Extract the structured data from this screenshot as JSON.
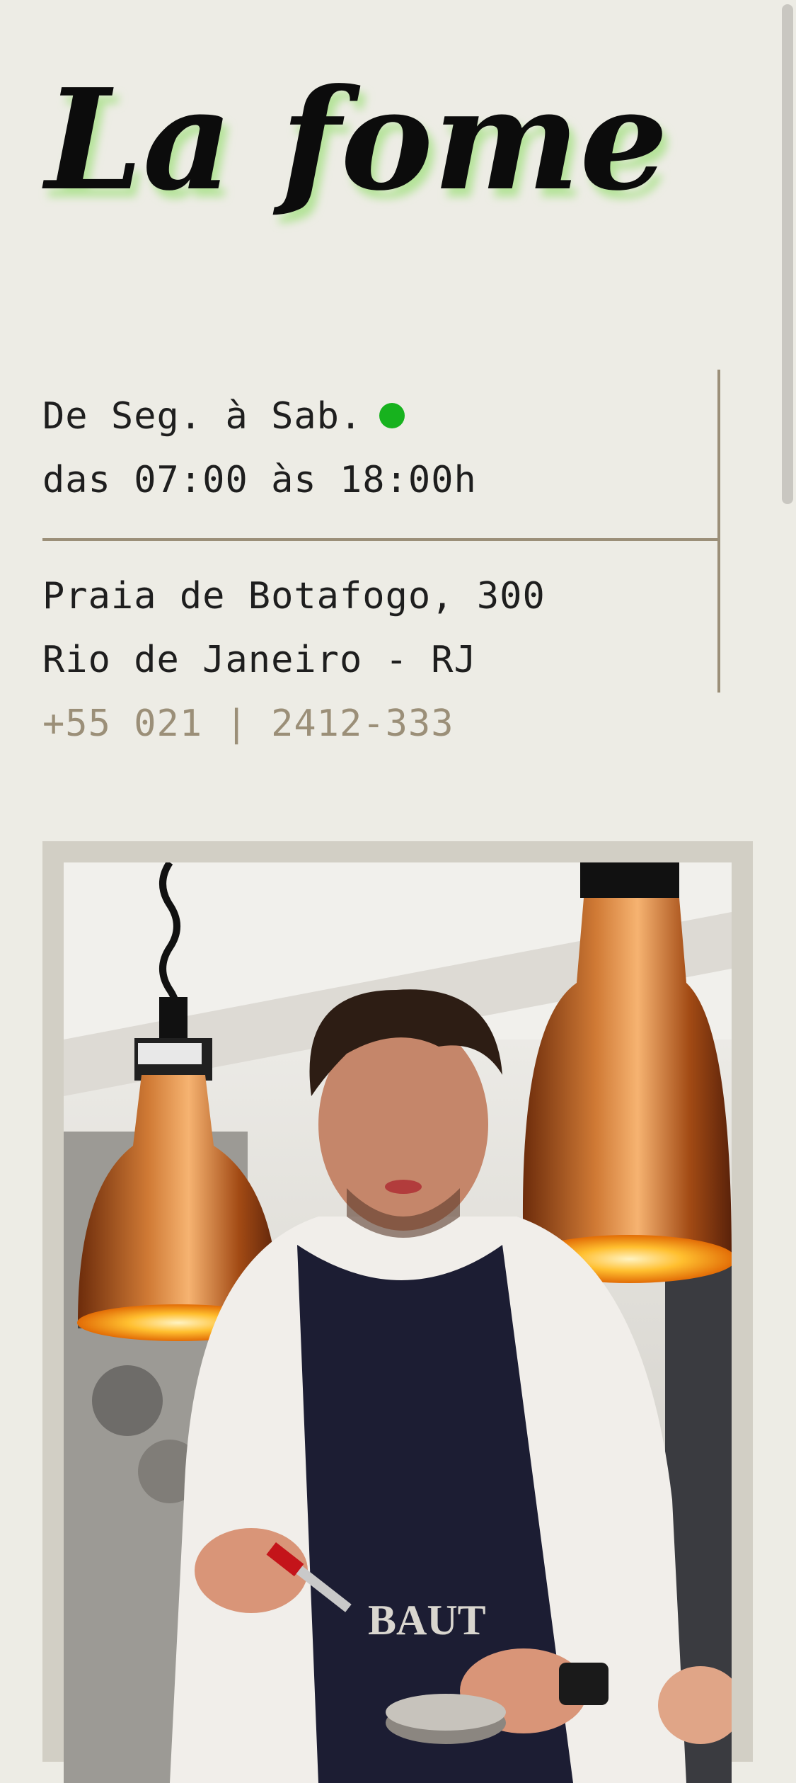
{
  "brand": {
    "logo_text": "La fome",
    "glow_color": "#b5e39a"
  },
  "hours": {
    "days": "De Seg. à Sab.",
    "time": "das 07:00 às 18:00h",
    "status_color": "#17b21e"
  },
  "address": {
    "street": "Praia de Botafogo, 300",
    "city": "Rio de Janeiro - RJ",
    "phone": "+55 021 | 2412-333"
  },
  "photo": {
    "subject": "chef-plating-under-heat-lamps"
  },
  "colors": {
    "background": "#edece5",
    "accent": "#9b8f78",
    "text": "#1e1e1e"
  }
}
